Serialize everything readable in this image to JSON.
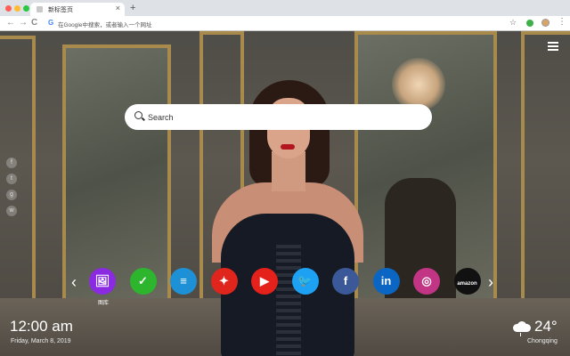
{
  "browser": {
    "tab_title": "新标签页",
    "tab_close": "×",
    "new_tab": "+",
    "back": "←",
    "forward": "→",
    "reload": "C",
    "omnibox_placeholder": "在Google中搜索，或者输入一个网址",
    "bookmark_star": "☆",
    "menu": "⋮"
  },
  "newtab": {
    "search_placeholder": "Search",
    "social_icons": [
      "f",
      "t",
      "g",
      "w"
    ],
    "prev_arrow": "‹",
    "next_arrow": "›",
    "apps": [
      {
        "name": "图库",
        "icon": "gallery-icon",
        "glyph": "🖼",
        "color": "#8a2be2"
      },
      {
        "name": "",
        "icon": "check-icon",
        "glyph": "✓",
        "color": "#2db52d"
      },
      {
        "name": "",
        "icon": "notes-icon",
        "glyph": "≡",
        "color": "#1e90d6"
      },
      {
        "name": "",
        "icon": "game-icon",
        "glyph": "✦",
        "color": "#e0261c"
      },
      {
        "name": "",
        "icon": "youtube-icon",
        "glyph": "▶",
        "color": "#e4211b"
      },
      {
        "name": "",
        "icon": "twitter-icon",
        "glyph": "🐦",
        "color": "#1da1f2"
      },
      {
        "name": "",
        "icon": "facebook-icon",
        "glyph": "f",
        "color": "#3b5998"
      },
      {
        "name": "",
        "icon": "linkedin-icon",
        "glyph": "in",
        "color": "#0a66c2"
      },
      {
        "name": "",
        "icon": "instagram-icon",
        "glyph": "◎",
        "color": "#c13584"
      },
      {
        "name": "",
        "icon": "amazon-icon",
        "glyph": "amazon",
        "color": "#111111"
      }
    ],
    "clock": "12:00 am",
    "date": "Friday, March 8, 2019",
    "temperature": "24°",
    "city": "Chongqing"
  }
}
